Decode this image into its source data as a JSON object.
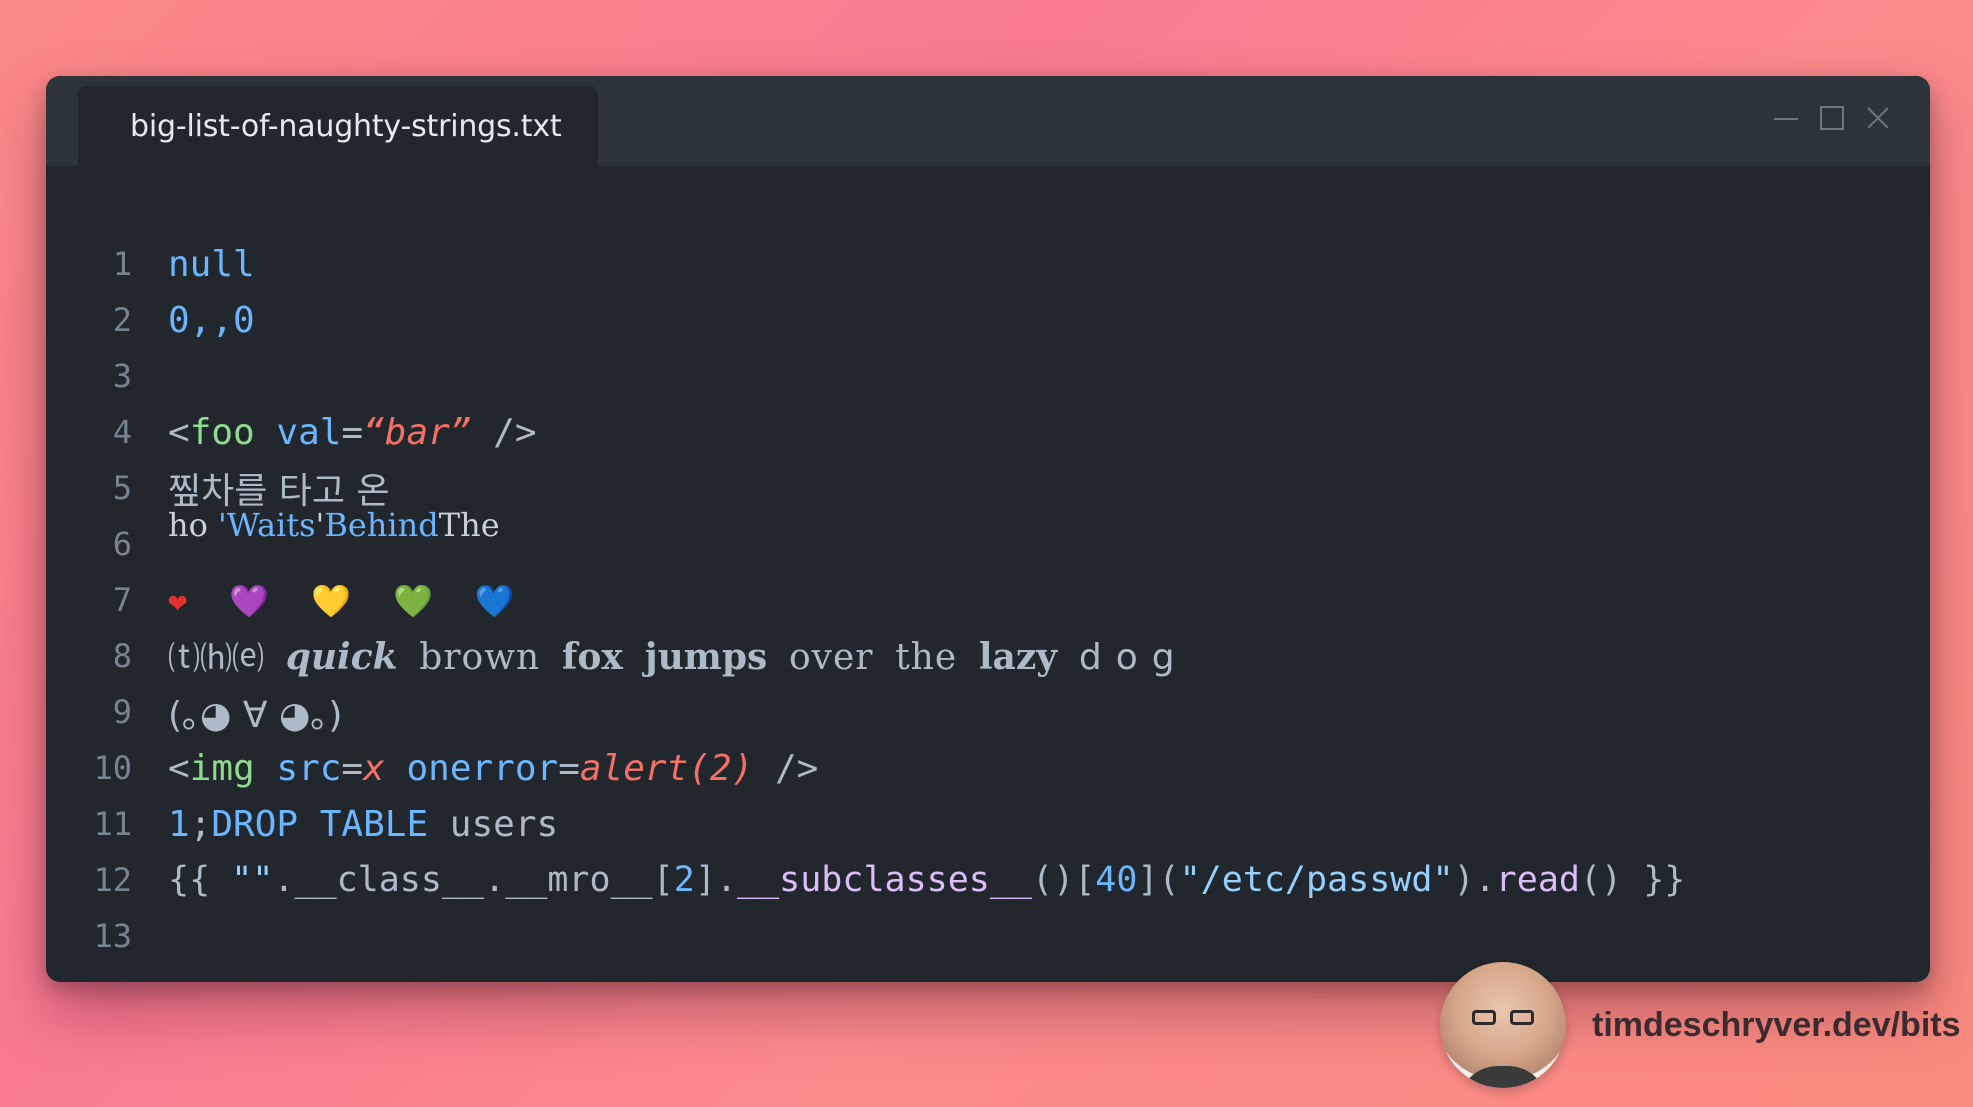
{
  "window": {
    "tab_title": "big-list-of-naughty-strings.txt"
  },
  "editor": {
    "line_numbers": [
      "1",
      "2",
      "3",
      "4",
      "5",
      "6",
      "7",
      "8",
      "9",
      "10",
      "11",
      "12",
      "13"
    ],
    "line1": "null",
    "line2": "0,,0",
    "line4": {
      "open": "<",
      "tag": "foo",
      "attr": " val",
      "eq": "=",
      "value": "“bar”",
      "close": " />"
    },
    "line5": "찦차를 타고 온",
    "line6": {
      "pre": "ho ",
      "hl1": "'Waits",
      "mid": "'",
      "hl2": "Behind",
      "post": "The"
    },
    "line7_hearts": [
      "❤",
      "💜",
      "💛",
      "💚",
      "💙"
    ],
    "line8": {
      "paren": "⒯⒣⒠",
      "quick": "quick",
      "brown": "brown",
      "fox": "fox",
      "jumps": "jumps",
      "over": "over",
      "the": "the",
      "lazy": "lazy",
      "dog": "dog"
    },
    "line9": "(｡◕ ∀ ◕｡)",
    "line10": {
      "open": "<",
      "tag": "img",
      "attr1": " src",
      "eq1": "=",
      "val1": "x",
      "attr2": " onerror",
      "eq2": "=",
      "val2": "alert(2)",
      "close": " />"
    },
    "line11": {
      "num": "1",
      "semi": ";",
      "kw": "DROP TABLE",
      "rest": " users"
    },
    "line12": {
      "open": "{{ ",
      "str": "\"\"",
      "dot1": ".",
      "cls": "__class__",
      "dot2": ".",
      "mro": "__mro__",
      "idx_open": "[",
      "idx": "2",
      "idx_close": "]",
      "dot3": ".",
      "sub": "__subclasses__",
      "call": "()",
      "idx2_open": "[",
      "idx2": "40",
      "idx2_close": "](",
      "path": "\"/etc/passwd\"",
      "paren_close": ")",
      "dot4": ".",
      "read": "read",
      "read_call": "()",
      "close": " }}"
    }
  },
  "author": {
    "link": "timdeschryver.dev/bits"
  },
  "colors": {
    "editor_bg": "#22272e",
    "titlebar_bg": "#2d333b",
    "keyword_blue": "#6cb6ff",
    "tag_green": "#8ddb8c",
    "string_red": "#f47067",
    "function_purple": "#dcbdfb"
  }
}
